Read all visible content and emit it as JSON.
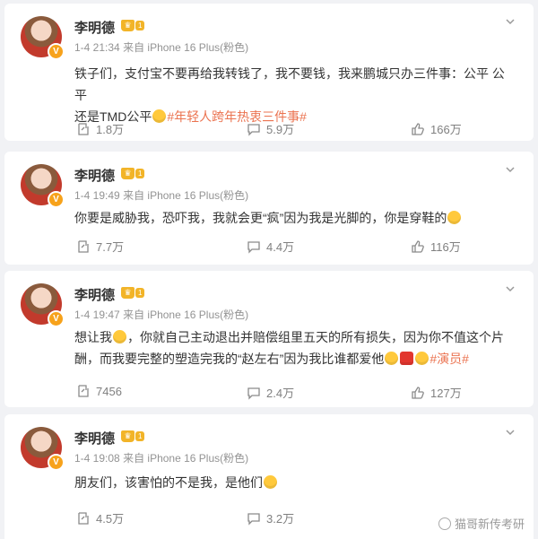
{
  "posts": [
    {
      "user": "李明德",
      "time": "1-4 21:34",
      "source": "来自 iPhone 16 Plus(粉色)",
      "text_lines": [
        "铁子们，支付宝不要再给我转钱了，我不要钱，我来鹏城只办三件事：公平 公平",
        "还是TMD公平"
      ],
      "hashtag": "#年轻人跨年热衷三件事#",
      "reposts": "1.8万",
      "comments": "5.9万",
      "likes": "166万"
    },
    {
      "user": "李明德",
      "time": "1-4 19:49",
      "source": "来自 iPhone 16 Plus(粉色)",
      "text_lines": [
        "你要是威胁我，恐吓我，我就会更“疯”因为我是光脚的，你是穿鞋的"
      ],
      "hashtag": "",
      "reposts": "7.7万",
      "comments": "4.4万",
      "likes": "116万"
    },
    {
      "user": "李明德",
      "time": "1-4 19:47",
      "source": "来自 iPhone 16 Plus(粉色)",
      "text_lines": [
        "想让我",
        "，你就自己主动退出并赔偿组里五天的所有损失，因为你不值这个片",
        "酬，而我要完整的塑造完我的“赵左右”因为我比谁都爱他"
      ],
      "hashtag": "#演员#",
      "reposts": "7456",
      "comments": "2.4万",
      "likes": "127万"
    },
    {
      "user": "李明德",
      "time": "1-4 19:08",
      "source": "来自 iPhone 16 Plus(粉色)",
      "text_lines": [
        "朋友们，该害怕的不是我，是他们"
      ],
      "hashtag": "",
      "reposts": "4.5万",
      "comments": "3.2万",
      "likes": ""
    }
  ],
  "badge": {
    "verified": "V",
    "level": "1"
  },
  "watermark": "猫哥新传考研",
  "colors": {
    "accent": "#eb7350",
    "verified": "#f7a21b",
    "crown": "#f2b428"
  },
  "icons": [
    "chevron-down-icon",
    "repost-icon",
    "comment-icon",
    "like-icon",
    "verified-icon",
    "crown-icon"
  ]
}
